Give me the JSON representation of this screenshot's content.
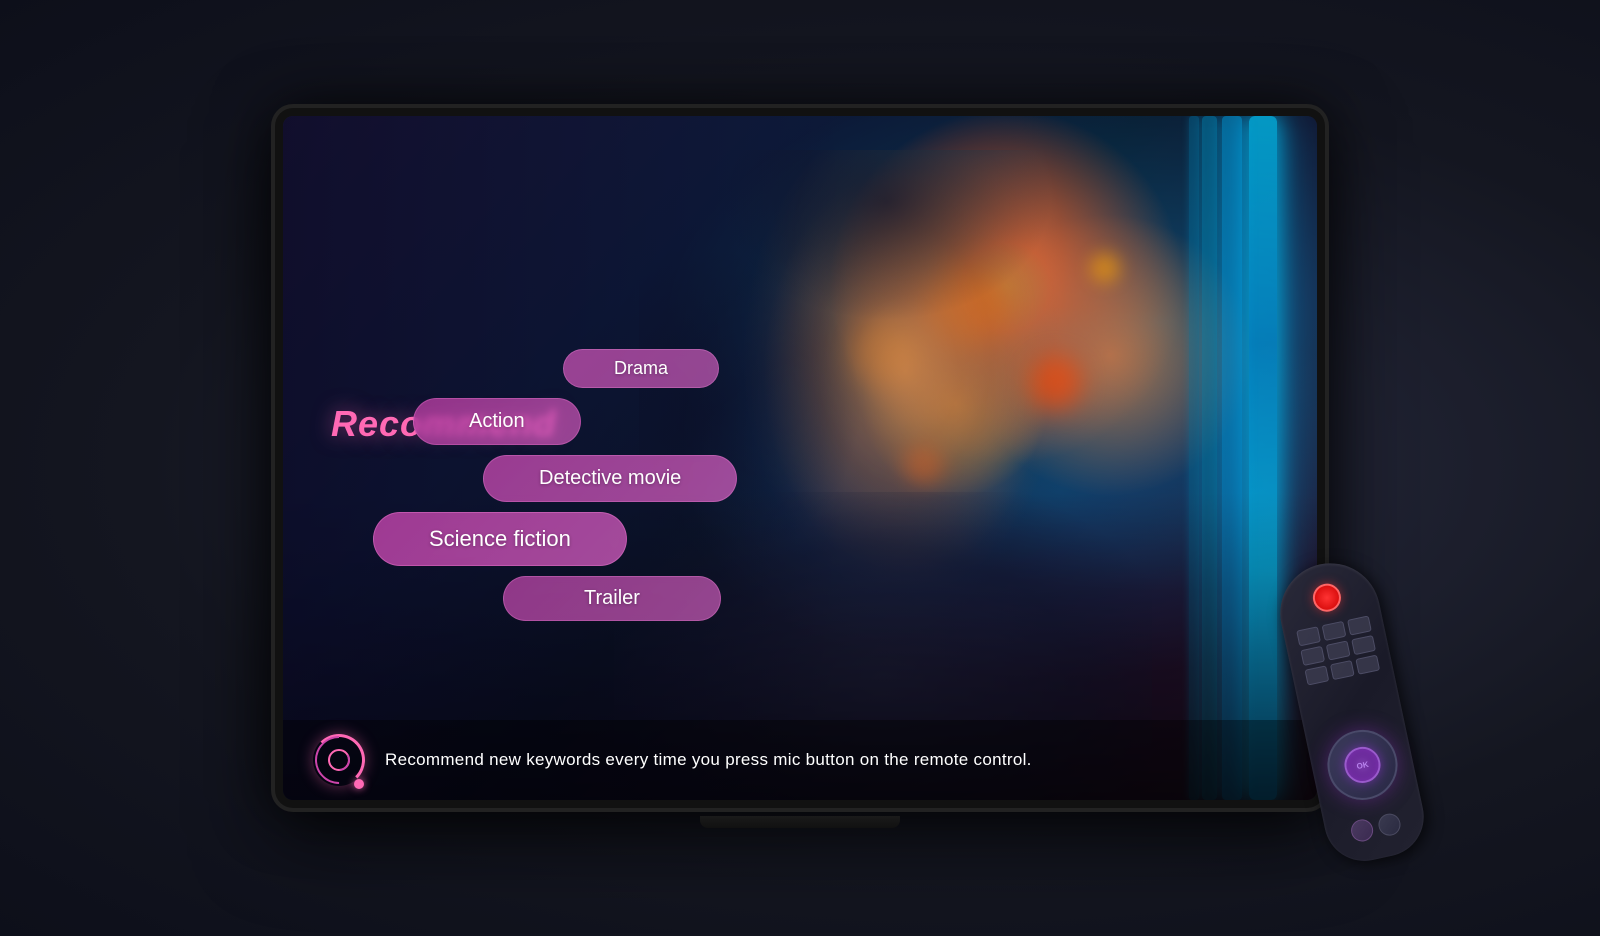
{
  "screen": {
    "recommend_label": "Recommend",
    "tags": [
      {
        "id": "drama",
        "label": "Drama"
      },
      {
        "id": "action",
        "label": "Action"
      },
      {
        "id": "detective",
        "label": "Detective movie"
      },
      {
        "id": "scifi",
        "label": "Science fiction"
      },
      {
        "id": "trailer",
        "label": "Trailer"
      }
    ],
    "bottom_text": "Recommend new keywords every time you press mic button on the remote control.",
    "mic_label": "mic"
  },
  "colors": {
    "recommend": "#ff69b4",
    "tag_bg": "rgba(190,65,170,0.8)",
    "neon_cyan": "#00e5ff",
    "neon_blue": "#0088ff",
    "accent_orange": "#ff6600"
  }
}
